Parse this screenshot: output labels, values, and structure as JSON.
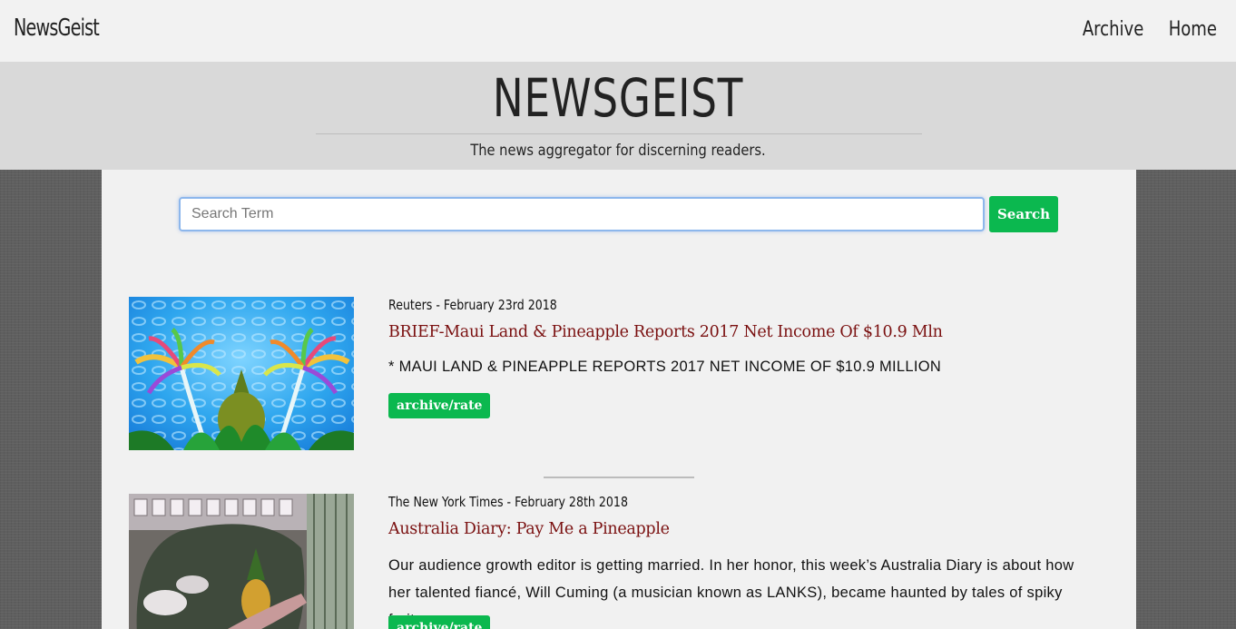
{
  "navbar": {
    "brand": "NewsGeist",
    "links": [
      {
        "label": "Archive"
      },
      {
        "label": "Home"
      }
    ]
  },
  "hero": {
    "title": "NEWSGEIST",
    "tagline": "The news aggregator for discerning readers."
  },
  "search": {
    "placeholder": "Search Term",
    "value": "",
    "button_label": "Search"
  },
  "colors": {
    "accent_green": "#0bb84f",
    "headline_red": "#7a1010",
    "navbar_bg": "#f2f2f2",
    "hero_bg": "#d9d9d9"
  },
  "articles": [
    {
      "meta": "Reuters - February 23rd 2018",
      "headline": "BRIEF-Maui Land & Pineapple Reports 2017 Net Income Of $10.9 Mln",
      "summary": "* MAUI LAND & PINEAPPLE REPORTS 2017 NET INCOME OF $10.9 MILLION",
      "button_label": "archive/rate",
      "image_icon": "palm-trees-image"
    },
    {
      "meta": "The New York Times - February 28th 2018",
      "headline": "Australia Diary: Pay Me a Pineapple",
      "summary": "Our audience growth editor is getting married. In her honor, this week’s Australia Diary is about how her talented fiancé, Will Cuming (a musician known as LANKS), became haunted by tales of spiky fruit.",
      "button_label": "archive/rate",
      "image_icon": "pineapple-still-life-image"
    }
  ]
}
